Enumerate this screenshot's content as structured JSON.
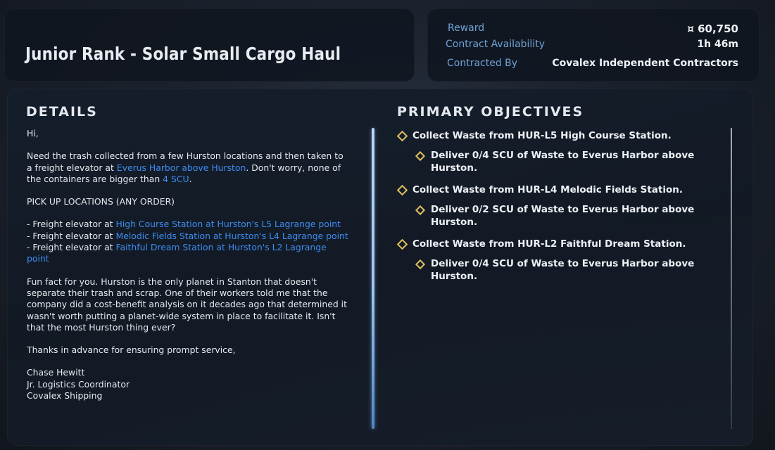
{
  "contract": {
    "title": "Junior Rank - Solar Small Cargo Haul"
  },
  "reward": {
    "reward_label": "Reward",
    "reward_value": "¤ 60,750",
    "availability_label": "Contract Availability",
    "availability_value": "1h 46m",
    "contracted_by_label": "Contracted By",
    "contracted_by_value": "Covalex Independent Contractors"
  },
  "details": {
    "heading": "DETAILS",
    "greeting": "Hi,",
    "p1_a": "Need the trash collected from a few Hurston locations and then taken to a freight elevator at ",
    "p1_link": "Everus Harbor above Hurston",
    "p1_b": ". Don't worry, none of the containers are bigger than ",
    "p1_link2": "4 SCU",
    "p1_c": ".",
    "pickup_heading": "PICK UP LOCATIONS (ANY ORDER)",
    "pickups": [
      {
        "prefix": "- Freight elevator at ",
        "link": "High Course Station at Hurston's L5 Lagrange point"
      },
      {
        "prefix": "- Freight elevator at ",
        "link": "Melodic Fields Station at Hurston's L4 Lagrange point"
      },
      {
        "prefix": "- Freight elevator at ",
        "link": "Faithful Dream Station at Hurston's L2 Lagrange point"
      }
    ],
    "fun_fact": "Fun fact for you. Hurston is the only planet in Stanton that doesn't separate their trash and scrap. One of their workers told me that the company did a cost-benefit analysis on it decades ago that determined it wasn't worth putting a planet-wide system in place to facilitate it. Isn't that the most Hurston thing ever?",
    "thanks": "Thanks in advance for ensuring prompt service,",
    "signature_name": "Chase Hewitt",
    "signature_role": "Jr. Logistics Coordinator",
    "signature_company": "Covalex Shipping"
  },
  "objectives": {
    "heading": "PRIMARY OBJECTIVES",
    "items": [
      {
        "main": "Collect Waste from HUR-L5 High Course Station.",
        "sub": "Deliver 0/4 SCU of Waste to Everus Harbor above Hurston."
      },
      {
        "main": "Collect Waste from HUR-L4 Melodic Fields Station.",
        "sub": "Deliver 0/2 SCU of Waste to Everus Harbor above Hurston."
      },
      {
        "main": "Collect Waste from HUR-L2 Faithful Dream Station.",
        "sub": "Deliver 0/4 SCU of Waste to Everus Harbor above Hurston."
      }
    ]
  },
  "colors": {
    "link": "#3d8df0",
    "label_blue": "#6ea3d9",
    "objective_marker": "#e0c060"
  }
}
